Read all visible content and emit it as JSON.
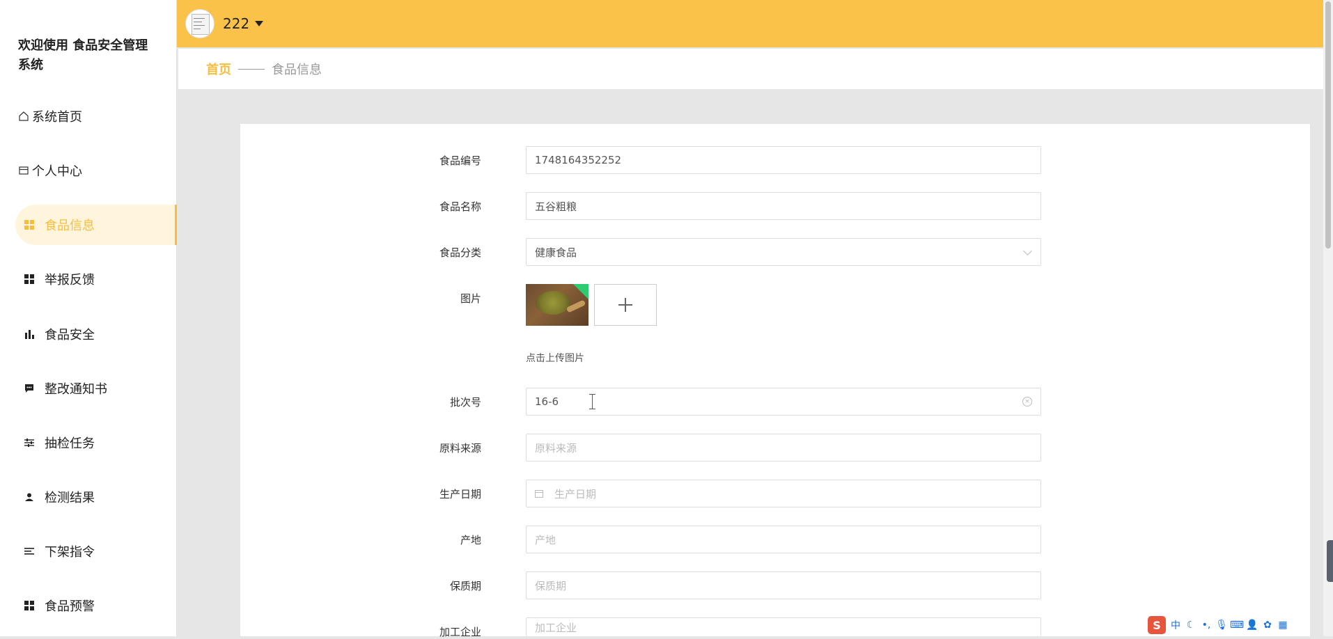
{
  "brand": {
    "line1": "欢迎使用 食品安全管理",
    "line2": "系统"
  },
  "sidebar": {
    "items": [
      {
        "label": "系统首页",
        "icon": "home-icon"
      },
      {
        "label": "个人中心",
        "icon": "card-icon"
      },
      {
        "label": "食品信息",
        "icon": "grid-icon"
      },
      {
        "label": "举报反馈",
        "icon": "grid-icon"
      },
      {
        "label": "食品安全",
        "icon": "bar-chart-icon"
      },
      {
        "label": "整改通知书",
        "icon": "chat-icon"
      },
      {
        "label": "抽检任务",
        "icon": "sliders-icon"
      },
      {
        "label": "检测结果",
        "icon": "user-icon"
      },
      {
        "label": "下架指令",
        "icon": "list-icon"
      },
      {
        "label": "食品预警",
        "icon": "grid-icon"
      }
    ]
  },
  "topbar": {
    "username": "222"
  },
  "breadcrumb": {
    "home": "首页",
    "current": "食品信息"
  },
  "form": {
    "food_code": {
      "label": "食品编号",
      "value": "1748164352252"
    },
    "food_name": {
      "label": "食品名称",
      "value": "五谷粗粮"
    },
    "category": {
      "label": "食品分类",
      "value": "健康食品"
    },
    "image": {
      "label": "图片",
      "hint": "点击上传图片"
    },
    "batch": {
      "label": "批次号",
      "value": "16-6"
    },
    "material_source": {
      "label": "原料来源",
      "placeholder": "原料来源"
    },
    "production_date": {
      "label": "生产日期",
      "placeholder": "生产日期"
    },
    "origin": {
      "label": "产地",
      "placeholder": "产地"
    },
    "shelf_life": {
      "label": "保质期",
      "placeholder": "保质期"
    },
    "processor": {
      "label": "加工企业",
      "placeholder": "加工企业"
    }
  },
  "ime": {
    "logo": "S",
    "mode": "中"
  }
}
